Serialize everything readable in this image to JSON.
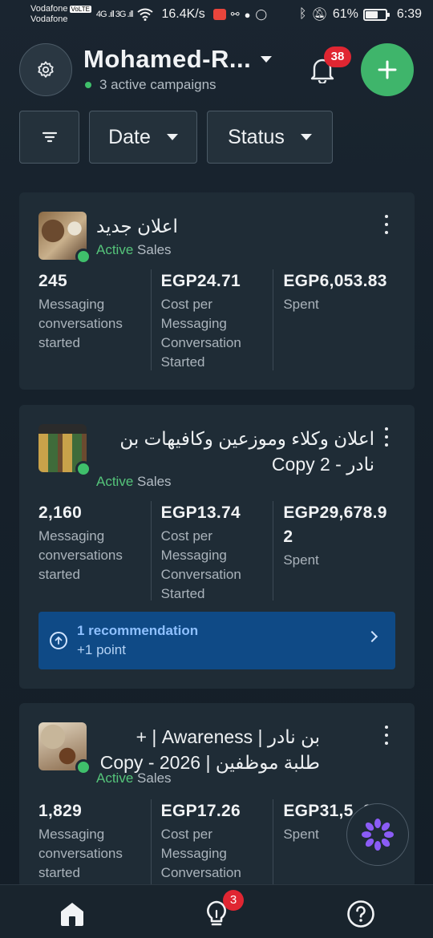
{
  "status_bar": {
    "carrier1": "Vodafone",
    "volte": "VoLTE",
    "carrier2": "Vodafone",
    "signal": "4G .ıll  3G .ıll",
    "speed": "16.4K/s",
    "battery_percent": "61%",
    "battery_level": 0.61,
    "time": "6:39"
  },
  "header": {
    "account_name": "Mohamed-R...",
    "active_campaigns": "3 active campaigns",
    "notifications_count": "38"
  },
  "filters": {
    "date_label": "Date",
    "status_label": "Status"
  },
  "campaigns": [
    {
      "title": "اعلان جديد",
      "status": "Active",
      "objective": "Sales",
      "metrics": [
        {
          "value": "245",
          "label": "Messaging conversations started"
        },
        {
          "value": "EGP24.71",
          "label": "Cost per Messaging Conversation Started"
        },
        {
          "value": "EGP6,053.83",
          "label": "Spent"
        }
      ]
    },
    {
      "title": "اعلان وكلاء وموزعين وكافيهات بن نادر - Copy 2",
      "status": "Active",
      "objective": "Sales",
      "metrics": [
        {
          "value": "2,160",
          "label": "Messaging conversations started"
        },
        {
          "value": "EGP13.74",
          "label": "Cost per Messaging Conversation Started"
        },
        {
          "value": "EGP29,678.92",
          "label": "Spent"
        }
      ],
      "recommendation": {
        "title": "1 recommendation",
        "points": "+1 point"
      }
    },
    {
      "title": "بن نادر | Awareness | + طلبة موظفين | 2026 - Copy",
      "status": "Active",
      "objective": "Sales",
      "metrics": [
        {
          "value": "1,829",
          "label": "Messaging conversations started"
        },
        {
          "value": "EGP17.26",
          "label": "Cost per Messaging Conversation"
        },
        {
          "value": "EGP31,5..37",
          "label": "Spent"
        }
      ]
    }
  ],
  "bottom_nav": {
    "ideas_badge": "3",
    "items": [
      "home-icon",
      "lightbulb-icon",
      "help-icon"
    ]
  },
  "colors": {
    "accent_green": "#3fb56b",
    "active_green": "#55c47a",
    "badge_red": "#e02632",
    "recommendation_blue": "#0f4a86"
  }
}
